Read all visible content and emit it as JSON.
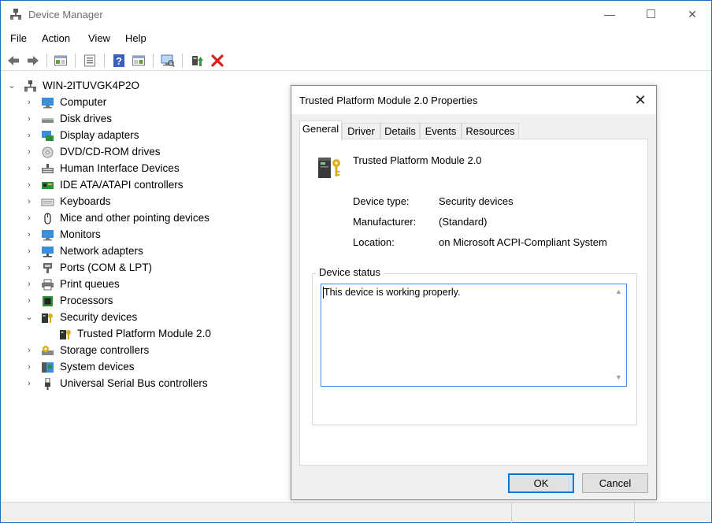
{
  "window": {
    "title": "Device Manager",
    "minimize_glyph": "—",
    "close_glyph": "✕"
  },
  "menu": [
    "File",
    "Action",
    "View",
    "Help"
  ],
  "toolbar": {
    "buttons": [
      "back-icon",
      "forward-icon",
      "show-hide-console-tree-icon",
      "properties-icon",
      "help-icon",
      "action-pane-icon",
      "scan-hardware-icon",
      "update-driver-icon",
      "uninstall-device-icon"
    ]
  },
  "tree": {
    "root": "WIN-2ITUVGK4P2O",
    "items": [
      {
        "label": "Computer",
        "icon": "computer-icon"
      },
      {
        "label": "Disk drives",
        "icon": "disk-drive-icon"
      },
      {
        "label": "Display adapters",
        "icon": "display-adapter-icon"
      },
      {
        "label": "DVD/CD-ROM drives",
        "icon": "dvd-drive-icon"
      },
      {
        "label": "Human Interface Devices",
        "icon": "hid-icon"
      },
      {
        "label": "IDE ATA/ATAPI controllers",
        "icon": "ide-controller-icon"
      },
      {
        "label": "Keyboards",
        "icon": "keyboard-icon"
      },
      {
        "label": "Mice and other pointing devices",
        "icon": "mouse-icon"
      },
      {
        "label": "Monitors",
        "icon": "monitor-icon"
      },
      {
        "label": "Network adapters",
        "icon": "network-adapter-icon"
      },
      {
        "label": "Ports (COM & LPT)",
        "icon": "port-icon"
      },
      {
        "label": "Print queues",
        "icon": "printer-icon"
      },
      {
        "label": "Processors",
        "icon": "processor-icon"
      },
      {
        "label": "Security devices",
        "icon": "security-device-icon",
        "expanded": true
      },
      {
        "label": "Trusted Platform Module 2.0",
        "icon": "tpm-icon",
        "child": true
      },
      {
        "label": "Storage controllers",
        "icon": "storage-controller-icon"
      },
      {
        "label": "System devices",
        "icon": "system-device-icon"
      },
      {
        "label": "Universal Serial Bus controllers",
        "icon": "usb-icon"
      }
    ]
  },
  "dialog": {
    "title": "Trusted Platform Module 2.0 Properties",
    "close_glyph": "✕",
    "tabs": [
      "General",
      "Driver",
      "Details",
      "Events",
      "Resources"
    ],
    "active_tab": "General",
    "device_name": "Trusted Platform Module 2.0",
    "properties": [
      {
        "label": "Device type:",
        "value": "Security devices"
      },
      {
        "label": "Manufacturer:",
        "value": "(Standard)"
      },
      {
        "label": "Location:",
        "value": "on Microsoft ACPI-Compliant System"
      }
    ],
    "status_group_title": "Device status",
    "status_text": "This device is working properly.",
    "ok_label": "OK",
    "cancel_label": "Cancel"
  }
}
